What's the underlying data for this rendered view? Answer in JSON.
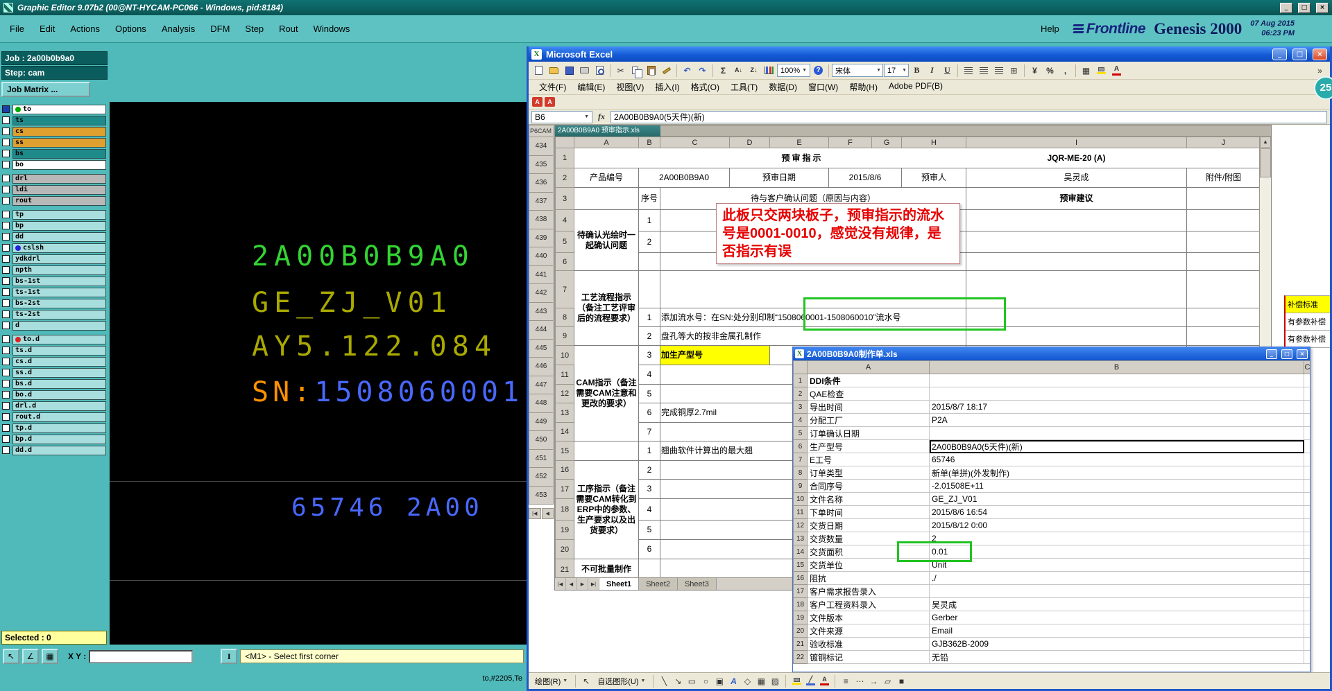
{
  "genesis": {
    "title": "Graphic Editor 9.07b2 (00@NT-HYCAM-PC066 - Windows, pid:8184)",
    "window_buttons": {
      "minimize": "_",
      "maximize": "□",
      "close": "×"
    },
    "menus": [
      "File",
      "Edit",
      "Actions",
      "Options",
      "Analysis",
      "DFM",
      "Step",
      "Rout",
      "Windows"
    ],
    "help_label": "Help",
    "brand": {
      "logo_text": "Frontline",
      "product": "Genesis 2000",
      "date": "07 Aug 2015",
      "time": "06:23 PM"
    },
    "job_label": "Job : 2a00b0b9a0",
    "step_label": "Step: cam",
    "job_matrix_label": "Job Matrix ...",
    "layers": [
      {
        "name": "to",
        "bg": "#ffffff",
        "dot": "#00aa00",
        "active": true
      },
      {
        "name": "ts",
        "bg": "#1f8a8a"
      },
      {
        "name": "cs",
        "bg": "#e0a030"
      },
      {
        "name": "ss",
        "bg": "#e0a030"
      },
      {
        "name": "bs",
        "bg": "#1f8a8a"
      },
      {
        "name": "bo",
        "bg": "#ffffff"
      },
      {
        "name": "drl",
        "bg": "#b8b8b8",
        "gap": true
      },
      {
        "name": "ldi",
        "bg": "#b8b8b8"
      },
      {
        "name": "rout",
        "bg": "#b8b8b8"
      },
      {
        "name": "tp",
        "bg": "#a9dede",
        "gap": true
      },
      {
        "name": "bp",
        "bg": "#a9dede"
      },
      {
        "name": "dd",
        "bg": "#a9dede"
      },
      {
        "name": "cslsh",
        "bg": "#a9dede",
        "dot": "#2222dd"
      },
      {
        "name": "ydkdrl",
        "bg": "#a9dede"
      },
      {
        "name": "npth",
        "bg": "#a9dede"
      },
      {
        "name": "bs-1st",
        "bg": "#a9dede"
      },
      {
        "name": "ts-1st",
        "bg": "#a9dede"
      },
      {
        "name": "bs-2st",
        "bg": "#a9dede"
      },
      {
        "name": "ts-2st",
        "bg": "#a9dede"
      },
      {
        "name": "d",
        "bg": "#a9dede"
      },
      {
        "name": "to.d",
        "bg": "#a9dede",
        "dot": "#dd2222",
        "gap": true
      },
      {
        "name": "ts.d",
        "bg": "#a9dede"
      },
      {
        "name": "cs.d",
        "bg": "#a9dede"
      },
      {
        "name": "ss.d",
        "bg": "#a9dede"
      },
      {
        "name": "bs.d",
        "bg": "#a9dede"
      },
      {
        "name": "bo.d",
        "bg": "#a9dede"
      },
      {
        "name": "drl.d",
        "bg": "#a9dede"
      },
      {
        "name": "rout.d",
        "bg": "#a9dede"
      },
      {
        "name": "tp.d",
        "bg": "#a9dede"
      },
      {
        "name": "bp.d",
        "bg": "#a9dede"
      },
      {
        "name": "dd.d",
        "bg": "#a9dede"
      }
    ],
    "canvas": {
      "part_number": "2A00B0B9A0",
      "file_name": "GE_ZJ_V01",
      "drawing_number": "AY5.122.084",
      "sn_label": "SN:",
      "sn_value": "1508060001",
      "bottom_text": "65746  2A00"
    },
    "selected_label": "Selected : 0",
    "xy_label": "X Y :",
    "xy_value": "",
    "prompt_message": "<M1> - Select first corner",
    "status_text": "to,#2205,Te",
    "badge_count": "25"
  },
  "excel": {
    "title": "Microsoft Excel",
    "window_buttons": {
      "minimize": "_",
      "restore": "□",
      "close": "×"
    },
    "menus": [
      "文件(F)",
      "编辑(E)",
      "视图(V)",
      "插入(I)",
      "格式(O)",
      "工具(T)",
      "数据(D)",
      "窗口(W)",
      "帮助(H)",
      "Adobe PDF(B)"
    ],
    "toolbar": {
      "zoom": "100%",
      "font_name": "宋体",
      "font_size": "17",
      "bold": "B",
      "italic": "I",
      "underline": "U"
    },
    "formula_bar": {
      "name_box": "B6",
      "function_label": "fx",
      "formula": "2A00B0B9A0(5天件)(新)"
    },
    "background_sheet": {
      "corner_text": "P6CAM",
      "row_numbers": [
        "434",
        "435",
        "436",
        "437",
        "438",
        "439",
        "440",
        "441",
        "442",
        "443",
        "444",
        "445",
        "446",
        "447",
        "448",
        "449",
        "450",
        "451",
        "452",
        "453"
      ]
    },
    "review_window": {
      "title": "2A00B0B9A0 预审指示.xls",
      "columns": [
        "A",
        "B",
        "C",
        "D",
        "E",
        "F",
        "G",
        "H",
        "I",
        "J"
      ],
      "row_numbers": [
        "1",
        "2",
        "3",
        "4",
        "5",
        "6",
        "7",
        "8",
        "9",
        "10",
        "11",
        "12",
        "13",
        "14",
        "15",
        "16",
        "17",
        "18",
        "19",
        "20",
        "21"
      ],
      "doc_title": "预审指示",
      "doc_code": "JQR-ME-20 (A)",
      "header_row": {
        "product_label": "产品编号",
        "product_value": "2A00B0B9A0",
        "date_label": "预审日期",
        "date_value": "2015/8/6",
        "reviewer_label": "预审人",
        "reviewer_value": "吴灵成",
        "attachment_label": "附件/附图"
      },
      "table_head": {
        "seq": "序号",
        "question": "待与客户确认问题（原因与内容）",
        "advice": "预审建议"
      },
      "groups": {
        "confirm": "待确认光绘时一起确认问题",
        "process": "工艺流程指示（备注工艺评审后的流程要求）",
        "cam": "CAM指示（备注需要CAM注意和更改的要求）",
        "ops": "工序指示（备注需要CAM转化到ERP中的参数、生产要求以及出货要求）",
        "note": "不可批量制作"
      },
      "items": {
        "serial": "添加流水号：在SN:处分别印制“1508060001-1508060010”流水号",
        "hole": "盘孔等大的按非金属孔制作",
        "model": "加生产型号",
        "copper": "完成铜厚2.7mil",
        "warp": "翘曲软件计算出的最大翘"
      },
      "seq": {
        "r4": "1",
        "r5": "2",
        "r8": "1",
        "r9": "2",
        "r10": "3",
        "r11": "4",
        "r12": "5",
        "r13": "6",
        "r14": "7",
        "r15": "1",
        "r16": "2",
        "r17": "3",
        "r18": "4",
        "r19": "5",
        "r20": "6"
      },
      "tabs": [
        "Sheet1",
        "Sheet2",
        "Sheet3"
      ],
      "annotation": "此板只交两块板子，预审指示的流水号是0001-0010，感觉没有规律，是否指示有误"
    },
    "mto_window": {
      "title": "2A00B0B9A0制作单.xls",
      "columns": [
        "A",
        "B",
        "C"
      ],
      "rows": [
        {
          "n": "1",
          "label": "DDI条件",
          "value": ""
        },
        {
          "n": "2",
          "label": "QAE检查",
          "value": ""
        },
        {
          "n": "3",
          "label": "导出时间",
          "value": "2015/8/7 18:17"
        },
        {
          "n": "4",
          "label": "分配工厂",
          "value": "P2A"
        },
        {
          "n": "5",
          "label": "订单确认日期",
          "value": ""
        },
        {
          "n": "6",
          "label": "生产型号",
          "value": "2A00B0B9A0(5天件)(新)"
        },
        {
          "n": "7",
          "label": "E工号",
          "value": "65746"
        },
        {
          "n": "8",
          "label": "订单类型",
          "value": "新单(单拼)(外发制作)"
        },
        {
          "n": "9",
          "label": "合同序号",
          "value": "-2.01508E+11"
        },
        {
          "n": "10",
          "label": "文件名称",
          "value": "GE_ZJ_V01"
        },
        {
          "n": "11",
          "label": "下单时间",
          "value": "2015/8/6 16:54"
        },
        {
          "n": "12",
          "label": "交货日期",
          "value": "2015/8/12 0:00"
        },
        {
          "n": "13",
          "label": "交货数量",
          "value": "2"
        },
        {
          "n": "14",
          "label": "交货面积",
          "value": "0.01"
        },
        {
          "n": "15",
          "label": "交货单位",
          "value": "Unit"
        },
        {
          "n": "16",
          "label": "阻抗",
          "value": "./"
        },
        {
          "n": "17",
          "label": "客户需求报告录入",
          "value": ""
        },
        {
          "n": "18",
          "label": "客户工程资料录入",
          "value": "吴灵成"
        },
        {
          "n": "19",
          "label": "文件版本",
          "value": "Gerber"
        },
        {
          "n": "20",
          "label": "文件来源",
          "value": "Email"
        },
        {
          "n": "21",
          "label": "验收标准",
          "value": "GJB362B-2009"
        },
        {
          "n": "22",
          "label": "镀铜标记",
          "value": "无铅"
        }
      ]
    },
    "side_cells": [
      "补偿标准",
      "有参数补偿",
      "有参数补偿"
    ],
    "draw_toolbar": {
      "draw_label": "绘图(R)",
      "autoshapes_label": "自选图形(U)"
    }
  }
}
